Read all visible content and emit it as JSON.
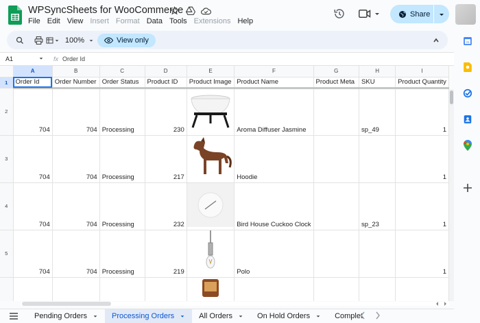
{
  "header": {
    "title": "WPSyncSheets for WooCommerce",
    "menu": [
      "File",
      "Edit",
      "View",
      "Insert",
      "Format",
      "Data",
      "Tools",
      "Extensions",
      "Help"
    ],
    "menu_disabled": [
      "Insert",
      "Format",
      "Extensions"
    ],
    "share_label": "Share"
  },
  "toolbar": {
    "zoom": "100%",
    "view_only_label": "View only"
  },
  "formula_bar": {
    "cell_ref": "A1",
    "content": "Order Id"
  },
  "grid": {
    "column_letters": [
      "A",
      "B",
      "C",
      "D",
      "E",
      "F",
      "G",
      "H",
      "I"
    ],
    "headers": [
      "Order Id",
      "Order Number",
      "Order Status",
      "Product ID",
      "Product Image",
      "Product Name",
      "Product Meta",
      "SKU",
      "Product Quantity"
    ],
    "rows": [
      {
        "row_number": "2",
        "order_id": "704",
        "order_number": "704",
        "status": "Processing",
        "product_id": "230",
        "image_icon": "bowl-stand-image",
        "product_name": "Aroma Diffuser Jasmine",
        "meta": "",
        "sku": "sp_49",
        "qty": "1"
      },
      {
        "row_number": "3",
        "order_id": "704",
        "order_number": "704",
        "status": "Processing",
        "product_id": "217",
        "image_icon": "wooden-horse-image",
        "product_name": "Hoodie",
        "meta": "",
        "sku": "",
        "qty": "1"
      },
      {
        "row_number": "4",
        "order_id": "704",
        "order_number": "704",
        "status": "Processing",
        "product_id": "232",
        "image_icon": "wall-clock-image",
        "product_name": "Bird House Cuckoo Clock",
        "meta": "",
        "sku": "sp_23",
        "qty": "1"
      },
      {
        "row_number": "5",
        "order_id": "704",
        "order_number": "704",
        "status": "Processing",
        "product_id": "219",
        "image_icon": "pendant-lamp-image",
        "product_name": "Polo",
        "meta": "",
        "sku": "",
        "qty": "1"
      }
    ]
  },
  "tabs": [
    {
      "label": "Pending Orders",
      "active": false
    },
    {
      "label": "Processing Orders",
      "active": true
    },
    {
      "label": "All Orders",
      "active": false
    },
    {
      "label": "On Hold Orders",
      "active": false
    },
    {
      "label": "Complet",
      "active": false
    }
  ],
  "colors": {
    "accent": "#0b57d0",
    "share_bg": "#c2e7ff",
    "sheets_green": "#0f9d58"
  }
}
